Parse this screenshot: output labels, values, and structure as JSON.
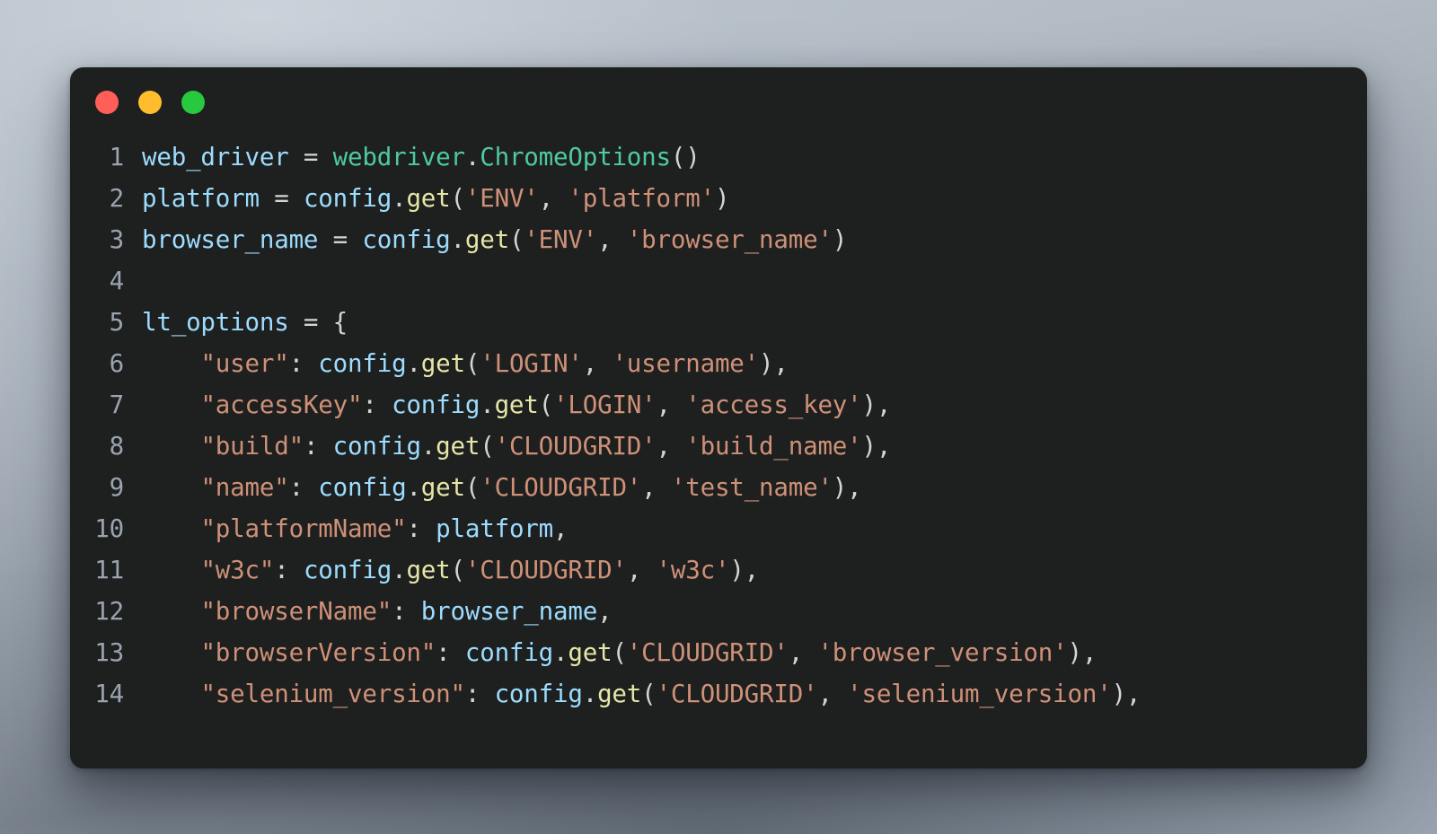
{
  "window": {
    "background_color": "#1e1f1f",
    "page_gradient_top": "#b9c1c9",
    "page_gradient_bottom": "#9ba5b1",
    "controls": [
      {
        "name": "close",
        "label": "Close",
        "color": "#ff5f56"
      },
      {
        "name": "minimize",
        "label": "Minimize",
        "color": "#ffbd2e"
      },
      {
        "name": "maximize",
        "label": "Maximize",
        "color": "#27c93f"
      }
    ]
  },
  "editor": {
    "language": "python",
    "first_line_number": 1,
    "last_line_number": 14,
    "colors": {
      "variable": "#9cdcfe",
      "function": "#e6e6a8",
      "class": "#4ec9a0",
      "string": "#ce9178",
      "punctuation": "#d4d4d4",
      "line_number": "#9aa4af"
    },
    "lines": [
      {
        "n": "1",
        "tokens": [
          {
            "t": "web_driver",
            "c": "var"
          },
          {
            "t": " = ",
            "c": "punc"
          },
          {
            "t": "webdriver",
            "c": "cls"
          },
          {
            "t": ".",
            "c": "dot"
          },
          {
            "t": "ChromeOptions",
            "c": "cls"
          },
          {
            "t": "()",
            "c": "punc"
          }
        ]
      },
      {
        "n": "2",
        "tokens": [
          {
            "t": "platform",
            "c": "var"
          },
          {
            "t": " = ",
            "c": "punc"
          },
          {
            "t": "config",
            "c": "var"
          },
          {
            "t": ".",
            "c": "dot"
          },
          {
            "t": "get",
            "c": "fn"
          },
          {
            "t": "(",
            "c": "punc"
          },
          {
            "t": "'ENV'",
            "c": "str"
          },
          {
            "t": ", ",
            "c": "punc"
          },
          {
            "t": "'platform'",
            "c": "str"
          },
          {
            "t": ")",
            "c": "punc"
          }
        ]
      },
      {
        "n": "3",
        "tokens": [
          {
            "t": "browser_name",
            "c": "var"
          },
          {
            "t": " = ",
            "c": "punc"
          },
          {
            "t": "config",
            "c": "var"
          },
          {
            "t": ".",
            "c": "dot"
          },
          {
            "t": "get",
            "c": "fn"
          },
          {
            "t": "(",
            "c": "punc"
          },
          {
            "t": "'ENV'",
            "c": "str"
          },
          {
            "t": ", ",
            "c": "punc"
          },
          {
            "t": "'browser_name'",
            "c": "str"
          },
          {
            "t": ")",
            "c": "punc"
          }
        ]
      },
      {
        "n": "4",
        "tokens": []
      },
      {
        "n": "5",
        "tokens": [
          {
            "t": "lt_options",
            "c": "var"
          },
          {
            "t": " = {",
            "c": "punc"
          }
        ]
      },
      {
        "n": "6",
        "tokens": [
          {
            "t": "    ",
            "c": "punc"
          },
          {
            "t": "\"user\"",
            "c": "str"
          },
          {
            "t": ": ",
            "c": "punc"
          },
          {
            "t": "config",
            "c": "var"
          },
          {
            "t": ".",
            "c": "dot"
          },
          {
            "t": "get",
            "c": "fn"
          },
          {
            "t": "(",
            "c": "punc"
          },
          {
            "t": "'LOGIN'",
            "c": "str"
          },
          {
            "t": ", ",
            "c": "punc"
          },
          {
            "t": "'username'",
            "c": "str"
          },
          {
            "t": "),",
            "c": "punc"
          }
        ]
      },
      {
        "n": "7",
        "tokens": [
          {
            "t": "    ",
            "c": "punc"
          },
          {
            "t": "\"accessKey\"",
            "c": "str"
          },
          {
            "t": ": ",
            "c": "punc"
          },
          {
            "t": "config",
            "c": "var"
          },
          {
            "t": ".",
            "c": "dot"
          },
          {
            "t": "get",
            "c": "fn"
          },
          {
            "t": "(",
            "c": "punc"
          },
          {
            "t": "'LOGIN'",
            "c": "str"
          },
          {
            "t": ", ",
            "c": "punc"
          },
          {
            "t": "'access_key'",
            "c": "str"
          },
          {
            "t": "),",
            "c": "punc"
          }
        ]
      },
      {
        "n": "8",
        "tokens": [
          {
            "t": "    ",
            "c": "punc"
          },
          {
            "t": "\"build\"",
            "c": "str"
          },
          {
            "t": ": ",
            "c": "punc"
          },
          {
            "t": "config",
            "c": "var"
          },
          {
            "t": ".",
            "c": "dot"
          },
          {
            "t": "get",
            "c": "fn"
          },
          {
            "t": "(",
            "c": "punc"
          },
          {
            "t": "'CLOUDGRID'",
            "c": "str"
          },
          {
            "t": ", ",
            "c": "punc"
          },
          {
            "t": "'build_name'",
            "c": "str"
          },
          {
            "t": "),",
            "c": "punc"
          }
        ]
      },
      {
        "n": "9",
        "tokens": [
          {
            "t": "    ",
            "c": "punc"
          },
          {
            "t": "\"name\"",
            "c": "str"
          },
          {
            "t": ": ",
            "c": "punc"
          },
          {
            "t": "config",
            "c": "var"
          },
          {
            "t": ".",
            "c": "dot"
          },
          {
            "t": "get",
            "c": "fn"
          },
          {
            "t": "(",
            "c": "punc"
          },
          {
            "t": "'CLOUDGRID'",
            "c": "str"
          },
          {
            "t": ", ",
            "c": "punc"
          },
          {
            "t": "'test_name'",
            "c": "str"
          },
          {
            "t": "),",
            "c": "punc"
          }
        ]
      },
      {
        "n": "10",
        "tokens": [
          {
            "t": "    ",
            "c": "punc"
          },
          {
            "t": "\"platformName\"",
            "c": "str"
          },
          {
            "t": ": ",
            "c": "punc"
          },
          {
            "t": "platform",
            "c": "var"
          },
          {
            "t": ",",
            "c": "punc"
          }
        ]
      },
      {
        "n": "11",
        "tokens": [
          {
            "t": "    ",
            "c": "punc"
          },
          {
            "t": "\"w3c\"",
            "c": "str"
          },
          {
            "t": ": ",
            "c": "punc"
          },
          {
            "t": "config",
            "c": "var"
          },
          {
            "t": ".",
            "c": "dot"
          },
          {
            "t": "get",
            "c": "fn"
          },
          {
            "t": "(",
            "c": "punc"
          },
          {
            "t": "'CLOUDGRID'",
            "c": "str"
          },
          {
            "t": ", ",
            "c": "punc"
          },
          {
            "t": "'w3c'",
            "c": "str"
          },
          {
            "t": "),",
            "c": "punc"
          }
        ]
      },
      {
        "n": "12",
        "tokens": [
          {
            "t": "    ",
            "c": "punc"
          },
          {
            "t": "\"browserName\"",
            "c": "str"
          },
          {
            "t": ": ",
            "c": "punc"
          },
          {
            "t": "browser_name",
            "c": "var"
          },
          {
            "t": ",",
            "c": "punc"
          }
        ]
      },
      {
        "n": "13",
        "tokens": [
          {
            "t": "    ",
            "c": "punc"
          },
          {
            "t": "\"browserVersion\"",
            "c": "str"
          },
          {
            "t": ": ",
            "c": "punc"
          },
          {
            "t": "config",
            "c": "var"
          },
          {
            "t": ".",
            "c": "dot"
          },
          {
            "t": "get",
            "c": "fn"
          },
          {
            "t": "(",
            "c": "punc"
          },
          {
            "t": "'CLOUDGRID'",
            "c": "str"
          },
          {
            "t": ", ",
            "c": "punc"
          },
          {
            "t": "'browser_version'",
            "c": "str"
          },
          {
            "t": "),",
            "c": "punc"
          }
        ]
      },
      {
        "n": "14",
        "tokens": [
          {
            "t": "    ",
            "c": "punc"
          },
          {
            "t": "\"selenium_version\"",
            "c": "str"
          },
          {
            "t": ": ",
            "c": "punc"
          },
          {
            "t": "config",
            "c": "var"
          },
          {
            "t": ".",
            "c": "dot"
          },
          {
            "t": "get",
            "c": "fn"
          },
          {
            "t": "(",
            "c": "punc"
          },
          {
            "t": "'CLOUDGRID'",
            "c": "str"
          },
          {
            "t": ", ",
            "c": "punc"
          },
          {
            "t": "'selenium_version'",
            "c": "str"
          },
          {
            "t": "),",
            "c": "punc"
          }
        ]
      }
    ]
  }
}
